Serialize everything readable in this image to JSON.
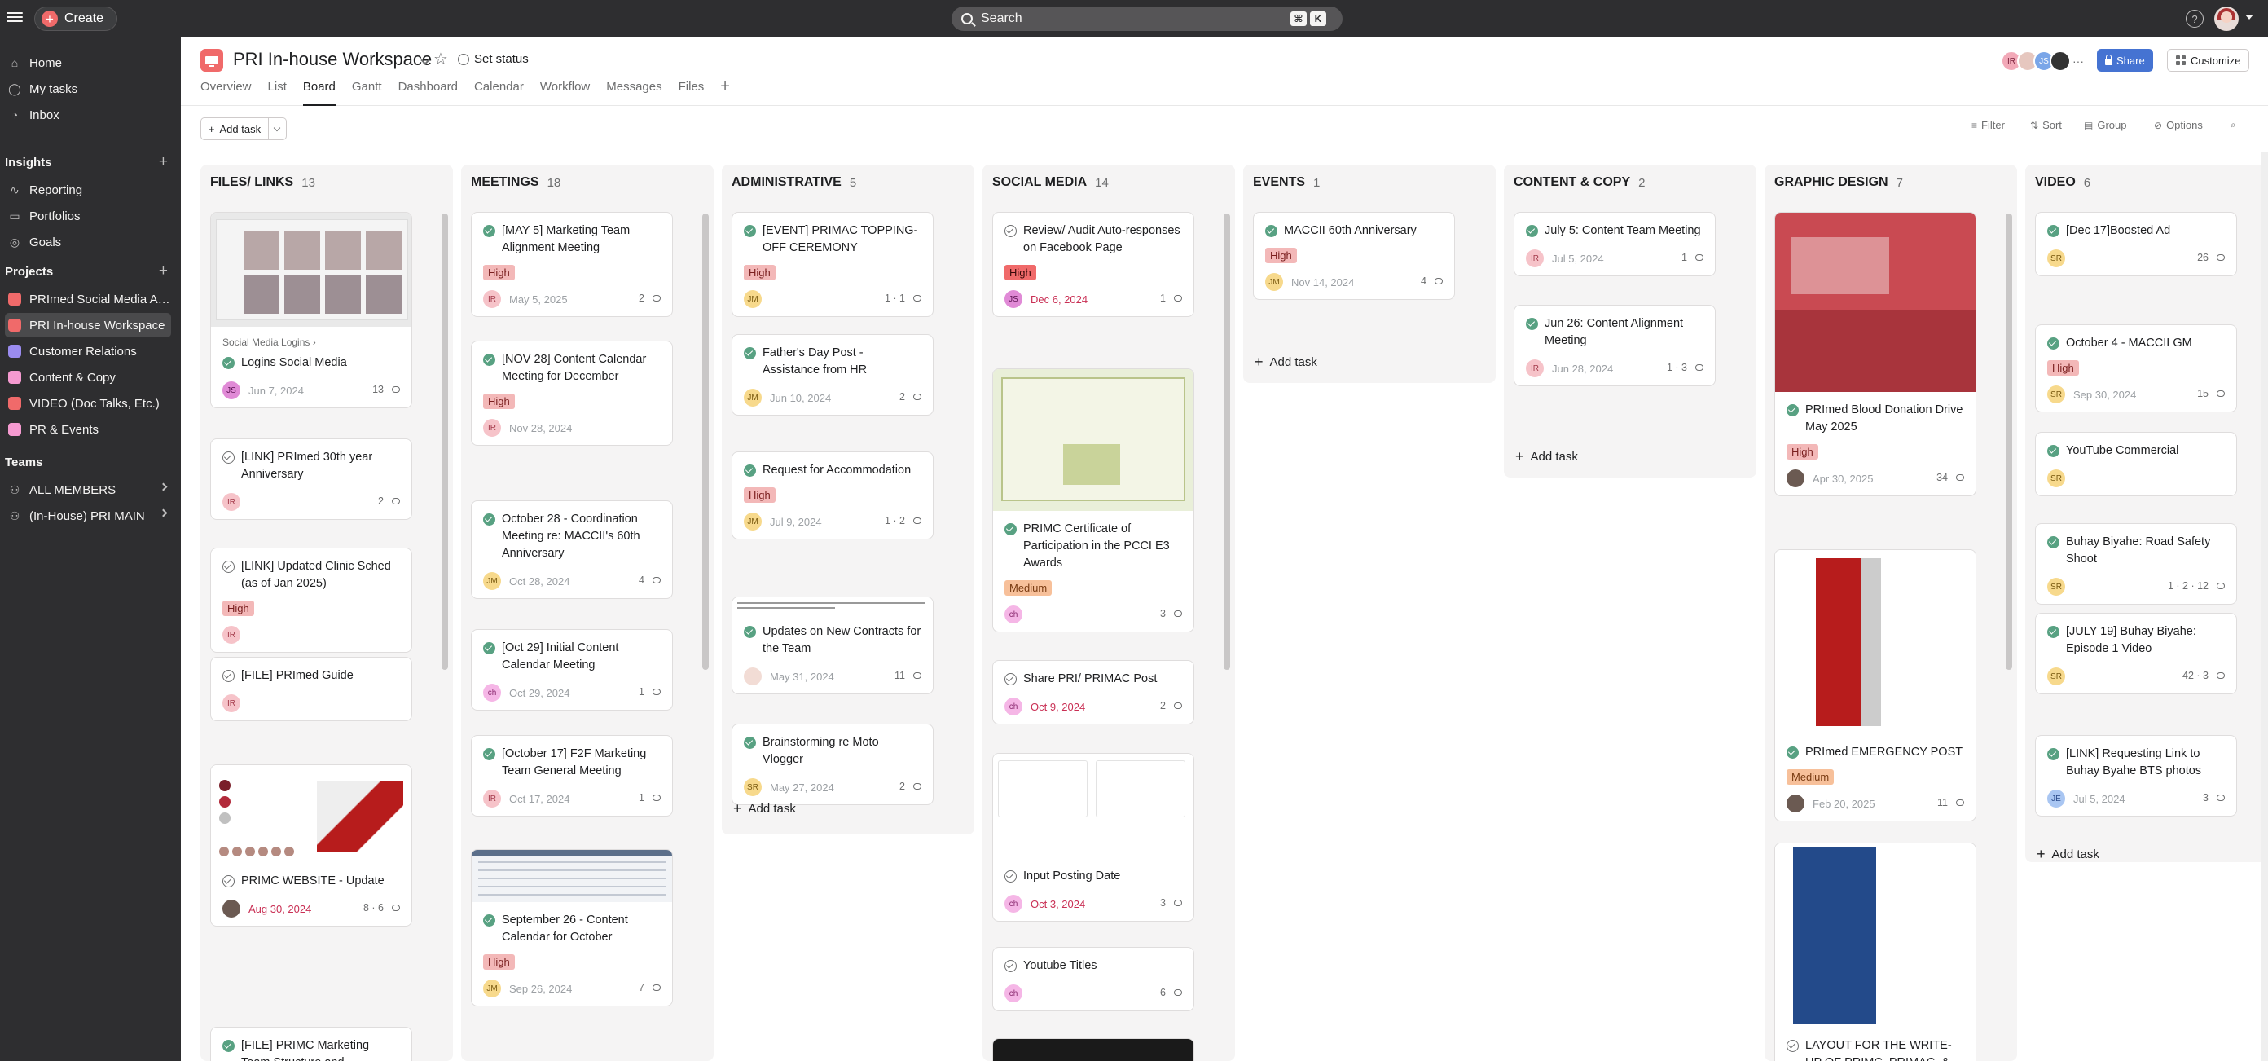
{
  "topbar": {
    "create_label": "Create",
    "search_placeholder": "Search",
    "kbd_cmd": "⌘",
    "kbd_k": "K",
    "help_label": "?"
  },
  "sidebar": {
    "nav": [
      {
        "label": "Home",
        "icon": "home-icon"
      },
      {
        "label": "My tasks",
        "icon": "check-circle-icon"
      },
      {
        "label": "Inbox",
        "icon": "bell-icon"
      }
    ],
    "insights_title": "Insights",
    "insights": [
      {
        "label": "Reporting",
        "icon": "chart-icon"
      },
      {
        "label": "Portfolios",
        "icon": "folder-icon"
      },
      {
        "label": "Goals",
        "icon": "person-icon"
      }
    ],
    "projects_title": "Projects",
    "projects": [
      {
        "label": "PRImed Social Media Art...",
        "color": "#f06a6a"
      },
      {
        "label": "PRI In-house Workspace",
        "color": "#f06a6a"
      },
      {
        "label": "Customer Relations",
        "color": "#9b8cf0"
      },
      {
        "label": "Content & Copy",
        "color": "#f59ad0"
      },
      {
        "label": "VIDEO (Doc Talks, Etc.)",
        "color": "#f06a6a"
      },
      {
        "label": "PR & Events",
        "color": "#f59ad0"
      }
    ],
    "teams_title": "Teams",
    "teams": [
      {
        "label": "ALL MEMBERS"
      },
      {
        "label": "(In-House) PRI MAIN"
      }
    ]
  },
  "header": {
    "title": "PRI In-house Workspace",
    "set_status": "Set status",
    "tabs": [
      "Overview",
      "List",
      "Board",
      "Gantt",
      "Dashboard",
      "Calendar",
      "Workflow",
      "Messages",
      "Files"
    ],
    "active_tab": "Board",
    "share_label": "Share",
    "customize_label": "Customize",
    "member_initials": [
      "IR",
      "",
      "JS",
      ""
    ],
    "more_label": "···"
  },
  "toolbar": {
    "add_task": "Add task",
    "filter": "Filter",
    "sort": "Sort",
    "group": "Group",
    "options": "Options"
  },
  "board": {
    "add_task_label": "Add task",
    "columns": [
      {
        "name": "FILES/ LINKS",
        "count": "13",
        "cards": [
          {
            "img": "screens",
            "sublabel": "Social Media Logins",
            "title": "Logins Social Media",
            "check": "done",
            "avatar": "JS",
            "due": "Jun 7, 2024",
            "stats": "13"
          },
          {
            "title": "[LINK] PRImed 30th year Anniversary",
            "check": "open",
            "avatar": "IR",
            "due": "",
            "stats": "2"
          },
          {
            "title": "[LINK] Updated Clinic Sched (as of Jan 2025)",
            "check": "open",
            "tag": "High",
            "avatar": "IR",
            "due": ""
          },
          {
            "title": "[FILE] PRImed Guide",
            "check": "open",
            "avatar": "IR",
            "due": ""
          },
          {
            "img": "palette",
            "title": "PRIMC WEBSITE - Update",
            "check": "open",
            "avatar": "photo",
            "due": "Aug 30, 2024",
            "due_red": true,
            "stats": "8 · 6"
          },
          {
            "title": "[FILE] PRIMC Marketing Team Structure and Organization",
            "check": "done"
          }
        ]
      },
      {
        "name": "MEETINGS",
        "count": "18",
        "cards": [
          {
            "title": "[MAY 5] Marketing Team Alignment Meeting",
            "check": "done",
            "tag": "High",
            "avatar": "IR",
            "due": "May 5, 2025",
            "stats": "2"
          },
          {
            "title": "[NOV 28] Content Calendar Meeting for December",
            "check": "done",
            "tag": "High",
            "avatar": "IR",
            "due": "Nov 28, 2024"
          },
          {
            "title": "October 28 - Coordination Meeting re: MACCII's 60th Anniversary",
            "check": "done",
            "avatar": "JM",
            "due": "Oct 28, 2024",
            "stats": "4"
          },
          {
            "title": "[Oct 29] Initial Content Calendar Meeting",
            "check": "done",
            "avatar": "ch",
            "due": "Oct 29, 2024",
            "stats": "1"
          },
          {
            "title": "[October 17] F2F Marketing Team General Meeting",
            "check": "done",
            "avatar": "IR",
            "due": "Oct 17, 2024",
            "stats": "1"
          },
          {
            "img": "table",
            "title": "September 26 - Content Calendar for October",
            "check": "done",
            "tag": "High",
            "avatar": "JM",
            "due": "Sep 26, 2024",
            "stats": "7"
          }
        ]
      },
      {
        "name": "ADMINISTRATIVE",
        "count": "5",
        "cards": [
          {
            "title": "[EVENT] PRIMAC TOPPING-OFF CEREMONY",
            "check": "done",
            "tag": "High",
            "avatar": "JM",
            "due": "",
            "stats": "1 · 1"
          },
          {
            "title": "Father's Day Post - Assistance from HR",
            "check": "done",
            "avatar": "JM",
            "due": "Jun 10, 2024",
            "stats": "2"
          },
          {
            "title": "Request for Accommodation",
            "check": "done",
            "tag": "High",
            "avatar": "JM",
            "due": "Jul 9, 2024",
            "stats": "1 · 2"
          },
          {
            "img": "letter",
            "title": "Updates on New Contracts for the Team",
            "check": "done",
            "avatar": "photo2",
            "due": "May 31, 2024",
            "stats": "11"
          },
          {
            "title": "Brainstorming re Moto Vlogger",
            "check": "done",
            "avatar": "SR",
            "due": "May 27, 2024",
            "stats": "2"
          }
        ]
      },
      {
        "name": "SOCIAL MEDIA",
        "count": "14",
        "cards": [
          {
            "title": "Review/ Audit Auto-responses on Facebook Page",
            "check": "open",
            "tag": "High",
            "tag_strong": true,
            "avatar": "JS",
            "due": "Dec 6, 2024",
            "due_red": true,
            "stats": "1"
          },
          {
            "img": "certificate",
            "title": "PRIMC Certificate of Participation in the PCCI E3 Awards",
            "check": "done",
            "tag": "Medium",
            "avatar": "ch",
            "due": "",
            "stats": "3"
          },
          {
            "title": "Share PRI/ PRIMAC Post",
            "check": "open",
            "avatar": "ch",
            "due": "Oct 9, 2024",
            "due_red": true,
            "stats": "2"
          },
          {
            "img": "kanban",
            "title": "Input Posting Date",
            "check": "open",
            "avatar": "ch",
            "due": "Oct 3, 2024",
            "due_red": true,
            "stats": "3"
          },
          {
            "title": "Youtube Titles",
            "check": "open",
            "avatar": "ch",
            "due": "",
            "stats": "6"
          },
          {
            "img": "darkpost",
            "title": ""
          }
        ]
      },
      {
        "name": "EVENTS",
        "count": "1",
        "cards": [
          {
            "title": "MACCII 60th Anniversary",
            "check": "done",
            "tag": "High",
            "avatar": "JM",
            "due": "Nov 14, 2024",
            "stats": "4"
          }
        ]
      },
      {
        "name": "CONTENT & COPY",
        "count": "2",
        "cards": [
          {
            "title": "July 5: Content Team Meeting",
            "check": "done",
            "avatar": "IR",
            "due": "Jul 5, 2024",
            "stats": "1"
          },
          {
            "title": "Jun 26: Content Alignment Meeting",
            "check": "done",
            "avatar": "IR",
            "due": "Jun 28, 2024",
            "stats": "1 · 3"
          }
        ]
      },
      {
        "name": "GRAPHIC DESIGN",
        "count": "7",
        "cards": [
          {
            "img": "blood",
            "title": "PRImed Blood Donation Drive May 2025",
            "check": "done",
            "tag": "High",
            "avatar": "photo",
            "due": "Apr 30, 2025",
            "stats": "34"
          },
          {
            "img": "emergency",
            "title": "PRImed EMERGENCY POST",
            "check": "done",
            "tag": "Medium",
            "avatar": "photo",
            "due": "Feb 20, 2025",
            "stats": "11"
          },
          {
            "img": "services",
            "title": "LAYOUT FOR THE WRITE-UP OF PRIMC, PRIMAC, & THE",
            "check": "open"
          }
        ]
      },
      {
        "name": "VIDEO",
        "count": "6",
        "cards": [
          {
            "title": "[Dec 17]Boosted Ad",
            "check": "done",
            "avatar": "SR",
            "due": "",
            "stats": "26"
          },
          {
            "title": "October 4 - MACCII GM",
            "check": "done",
            "tag": "High",
            "avatar": "SR",
            "due": "Sep 30, 2024",
            "stats": "15"
          },
          {
            "title": "YouTube Commercial",
            "check": "done",
            "avatar": "SR",
            "due": ""
          },
          {
            "title": "Buhay Biyahe: Road Safety Shoot",
            "check": "done",
            "avatar": "SR",
            "due": "",
            "stats": "1 · 2 · 12"
          },
          {
            "title": "[JULY 19] Buhay Biyahe: Episode 1 Video",
            "check": "done",
            "avatar": "SR",
            "due": "",
            "stats": "42 · 3"
          },
          {
            "title": "[LINK] Requesting Link to Buhay Byahe BTS photos",
            "check": "done",
            "avatar": "JE",
            "due": "Jul 5, 2024",
            "stats": "3"
          }
        ]
      }
    ]
  },
  "colors": {
    "accent": "#f06a6a",
    "share_blue": "#4573d2",
    "done_green": "#58a182",
    "high_tag": "#f3b8b8",
    "medium_tag": "#f7c09a",
    "overdue_red": "#c92f54"
  }
}
